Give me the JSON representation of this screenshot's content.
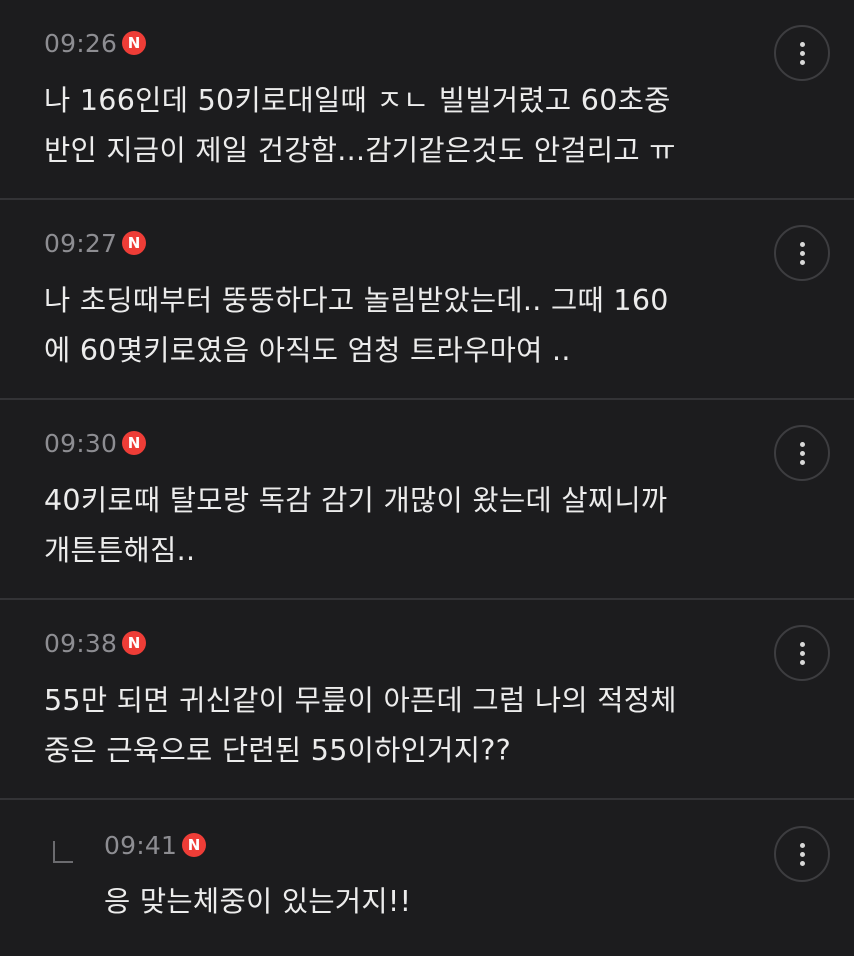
{
  "comments": [
    {
      "time": "09:26",
      "badge": "N",
      "text": "나 166인데 50키로대일때 ㅈㄴ 빌빌거렸고 60초중\n반인 지금이 제일 건강함...감기같은것도 안걸리고 ㅠ"
    },
    {
      "time": "09:27",
      "badge": "N",
      "text": "나 초딩때부터 뚱뚱하다고 놀림받았는데.. 그때 160\n에 60몇키로였음 아직도 엄청 트라우마여 .."
    },
    {
      "time": "09:30",
      "badge": "N",
      "text": "40키로때 탈모랑 독감 감기 개많이 왔는데 살찌니까\n개튼튼해짐.."
    },
    {
      "time": "09:38",
      "badge": "N",
      "text": "55만 되면 귀신같이 무릎이 아픈데 그럼 나의 적정체\n중은 근육으로 단련된 55이하인거지??"
    }
  ],
  "reply": {
    "time": "09:41",
    "badge": "N",
    "text": "응 맞는체중이 있는거지!!"
  },
  "icons": {
    "more": "more-vertical-icon",
    "reply": "reply-arrow-icon"
  },
  "colors": {
    "background": "#1c1c1e",
    "badge": "#ee3d37",
    "timestamp": "#8d8d92",
    "text": "#ececec",
    "divider": "#333336"
  }
}
